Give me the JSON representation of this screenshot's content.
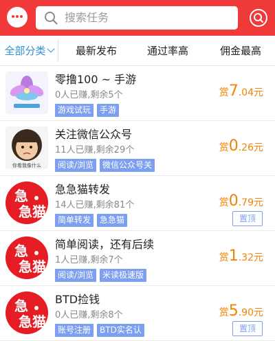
{
  "header": {
    "search_placeholder": "搜索任务",
    "accent": "#f03a3a"
  },
  "tabs": [
    {
      "label": "全部分类",
      "active": true
    },
    {
      "label": "最新发布",
      "active": false
    },
    {
      "label": "通过率高",
      "active": false
    },
    {
      "label": "佣金最高",
      "active": false
    }
  ],
  "tasks": [
    {
      "title": "零撸100 ~ 手游",
      "meta": "0人已赚,剩余5个",
      "tags": [
        "游戏试玩",
        "手游"
      ],
      "reward_prefix": "赏",
      "reward_int": "7",
      "reward_dec": ".04元",
      "pin": "",
      "thumb": "flower-game-thumbnail",
      "thumb_caption": ""
    },
    {
      "title": "关注微信公众号",
      "meta": "11人已赚,剩余29个",
      "tags": [
        "阅读/浏览",
        "微信公众号关"
      ],
      "reward_prefix": "赏",
      "reward_int": "0",
      "reward_dec": ".26元",
      "pin": "",
      "thumb": "child-photo-thumbnail",
      "thumb_caption": "你看我像什么"
    },
    {
      "title": "急急猫转发",
      "meta": "14人已赚,剩余81个",
      "tags": [
        "简单转发",
        "急急猫"
      ],
      "reward_prefix": "赏",
      "reward_int": "0",
      "reward_dec": ".79元",
      "pin": "置顶",
      "thumb": "jijimao-logo",
      "logo_top": "急",
      "logo_bottom": "急猫"
    },
    {
      "title": "简单阅读，还有后续",
      "meta": "1人已赚,剩余7个",
      "tags": [
        "阅读/浏览",
        "米读极速版"
      ],
      "reward_prefix": "赏",
      "reward_int": "1",
      "reward_dec": ".32元",
      "pin": "",
      "thumb": "jijimao-logo",
      "logo_top": "急",
      "logo_bottom": "急猫"
    },
    {
      "title": "BTD捡钱",
      "meta": "0人已赚,剩余8个",
      "tags": [
        "账号注册",
        "BTD实名认"
      ],
      "reward_prefix": "赏",
      "reward_int": "5",
      "reward_dec": ".90元",
      "pin": "置顶",
      "thumb": "jijimao-logo",
      "logo_top": "急",
      "logo_bottom": "急猫"
    }
  ],
  "colors": {
    "tab_active": "#2f8fd8",
    "reward": "#f08300",
    "tag_bg": "#7d9ff0"
  }
}
